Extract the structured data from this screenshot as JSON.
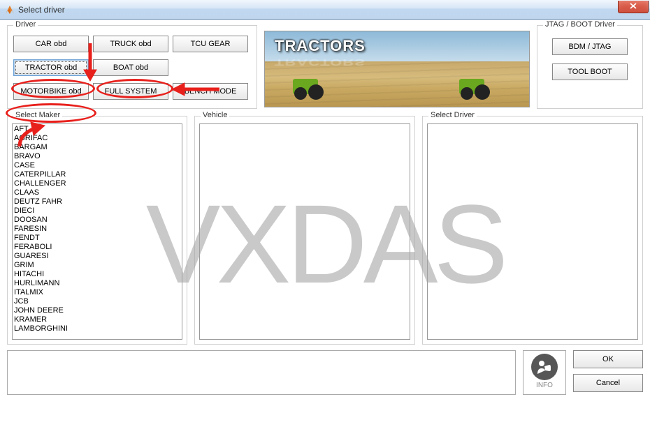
{
  "window": {
    "title": "Select driver"
  },
  "driver_group": {
    "legend": "Driver",
    "buttons": [
      "CAR  obd",
      "TRUCK  obd",
      "TCU GEAR",
      "TRACTOR  obd",
      "BOAT  obd",
      "",
      "MOTORBIKE  obd",
      "FULL SYSTEM",
      "BENCH MODE"
    ],
    "selected_index": 3
  },
  "banner": {
    "title": "TRACTORS"
  },
  "jtag_group": {
    "legend": "JTAG / BOOT Driver",
    "buttons": [
      "BDM / JTAG",
      "TOOL BOOT"
    ]
  },
  "maker_group": {
    "legend": "Select Maker",
    "items": [
      "AFT",
      "AGRIFAC",
      "BARGAM",
      "BRAVO",
      "CASE",
      "CATERPILLAR",
      "CHALLENGER",
      "CLAAS",
      "DEUTZ FAHR",
      "DIECI",
      "DOOSAN",
      "FARESIN",
      "FENDT",
      "FERABOLI",
      "GUARESI",
      "GRIM",
      "HITACHI",
      "HURLIMANN",
      "ITALMIX",
      "JCB",
      "JOHN DEERE",
      "KRAMER",
      "LAMBORGHINI"
    ]
  },
  "vehicle_group": {
    "legend": "Vehicle"
  },
  "select_driver_group": {
    "legend": "Select Driver"
  },
  "bottom": {
    "info_label": "INFO",
    "ok_label": "OK",
    "cancel_label": "Cancel"
  },
  "watermark": "VXDAS"
}
